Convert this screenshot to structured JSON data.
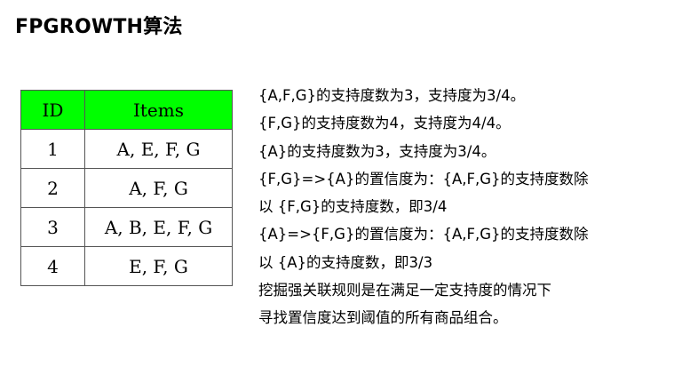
{
  "title": "FPGROWTH算法",
  "table": {
    "headers": [
      "ID",
      "Items"
    ],
    "rows": [
      [
        "1",
        "A, E, F, G"
      ],
      [
        "2",
        "A, F, G"
      ],
      [
        "3",
        "A, B, E, F, G"
      ],
      [
        "4",
        "E, F, G"
      ]
    ]
  },
  "text_lines": [
    "{A,F,G}的支持度数为3，支持度为3/4。",
    "{F,G}的支持度数为4，支持度为4/4。",
    "{A}的支持度数为3，支持度为3/4。",
    "{F,G}=>{A}的置信度为：{A,F,G}的支持度数除",
    "以 {F,G}的支持度数，即3/4",
    "{A}=>{F,G}的置信度为：{A,F,G}的支持度数除",
    "以 {A}的支持度数，即3/3",
    "挖掘强关联规则是在满足一定支持度的情况下",
    "寻找置信度达到阈值的所有商品组合。"
  ]
}
